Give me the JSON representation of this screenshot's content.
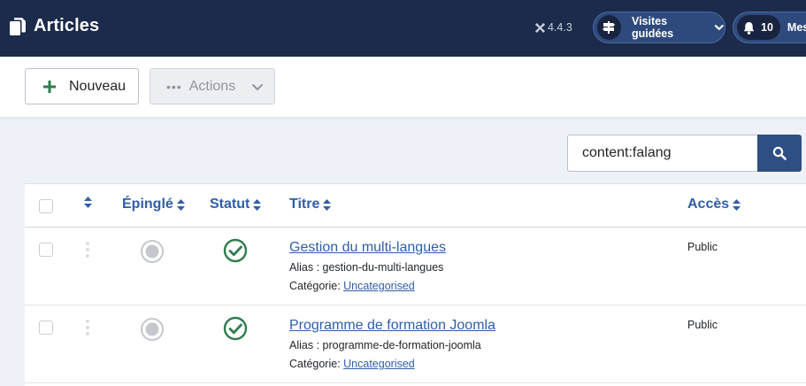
{
  "header": {
    "title": "Articles",
    "version": "4.4.3",
    "guided_tours_label": "Visites guidées",
    "notifications_count": "10",
    "messages_label": "Mes"
  },
  "toolbar": {
    "new_label": "Nouveau",
    "actions_label": "Actions"
  },
  "search": {
    "value": "content:falang"
  },
  "table": {
    "columns": {
      "pinned": "Épinglé",
      "status": "Statut",
      "title": "Titre",
      "access": "Accès"
    },
    "alias_prefix": "Alias : ",
    "category_prefix": "Catégorie: ",
    "rows": [
      {
        "title": "Gestion du multi-langues",
        "alias": "gestion-du-multi-langues",
        "category": "Uncategorised",
        "access": "Public"
      },
      {
        "title": "Programme de formation Joomla",
        "alias": "programme-de-formation-joomla",
        "category": "Uncategorised",
        "access": "Public"
      }
    ]
  },
  "colors": {
    "header_bg": "#1c2a4b",
    "pill_bg": "#2e4a7d",
    "link": "#2f5ea8",
    "success": "#2f7d4e",
    "search_btn": "#2f4f83"
  }
}
